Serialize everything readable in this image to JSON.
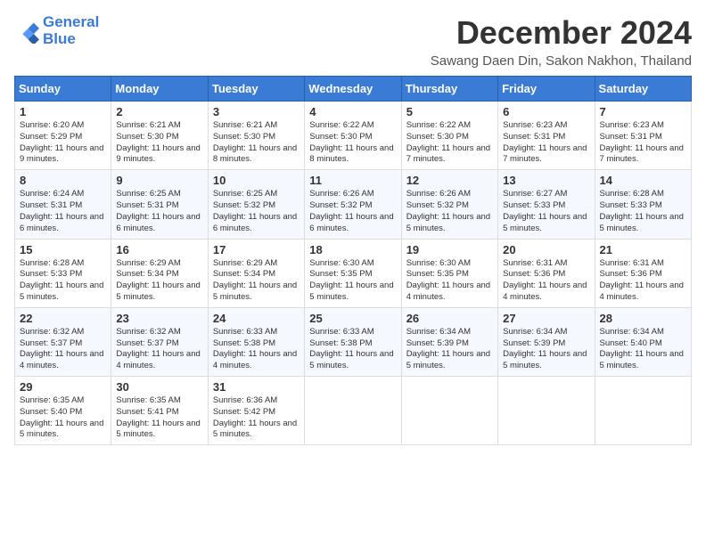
{
  "header": {
    "logo_line1": "General",
    "logo_line2": "Blue",
    "title": "December 2024",
    "location": "Sawang Daen Din, Sakon Nakhon, Thailand"
  },
  "weekdays": [
    "Sunday",
    "Monday",
    "Tuesday",
    "Wednesday",
    "Thursday",
    "Friday",
    "Saturday"
  ],
  "weeks": [
    [
      {
        "day": "1",
        "sunrise": "6:20 AM",
        "sunset": "5:29 PM",
        "daylight": "11 hours and 9 minutes."
      },
      {
        "day": "2",
        "sunrise": "6:21 AM",
        "sunset": "5:30 PM",
        "daylight": "11 hours and 9 minutes."
      },
      {
        "day": "3",
        "sunrise": "6:21 AM",
        "sunset": "5:30 PM",
        "daylight": "11 hours and 8 minutes."
      },
      {
        "day": "4",
        "sunrise": "6:22 AM",
        "sunset": "5:30 PM",
        "daylight": "11 hours and 8 minutes."
      },
      {
        "day": "5",
        "sunrise": "6:22 AM",
        "sunset": "5:30 PM",
        "daylight": "11 hours and 7 minutes."
      },
      {
        "day": "6",
        "sunrise": "6:23 AM",
        "sunset": "5:31 PM",
        "daylight": "11 hours and 7 minutes."
      },
      {
        "day": "7",
        "sunrise": "6:23 AM",
        "sunset": "5:31 PM",
        "daylight": "11 hours and 7 minutes."
      }
    ],
    [
      {
        "day": "8",
        "sunrise": "6:24 AM",
        "sunset": "5:31 PM",
        "daylight": "11 hours and 6 minutes."
      },
      {
        "day": "9",
        "sunrise": "6:25 AM",
        "sunset": "5:31 PM",
        "daylight": "11 hours and 6 minutes."
      },
      {
        "day": "10",
        "sunrise": "6:25 AM",
        "sunset": "5:32 PM",
        "daylight": "11 hours and 6 minutes."
      },
      {
        "day": "11",
        "sunrise": "6:26 AM",
        "sunset": "5:32 PM",
        "daylight": "11 hours and 6 minutes."
      },
      {
        "day": "12",
        "sunrise": "6:26 AM",
        "sunset": "5:32 PM",
        "daylight": "11 hours and 5 minutes."
      },
      {
        "day": "13",
        "sunrise": "6:27 AM",
        "sunset": "5:33 PM",
        "daylight": "11 hours and 5 minutes."
      },
      {
        "day": "14",
        "sunrise": "6:28 AM",
        "sunset": "5:33 PM",
        "daylight": "11 hours and 5 minutes."
      }
    ],
    [
      {
        "day": "15",
        "sunrise": "6:28 AM",
        "sunset": "5:33 PM",
        "daylight": "11 hours and 5 minutes."
      },
      {
        "day": "16",
        "sunrise": "6:29 AM",
        "sunset": "5:34 PM",
        "daylight": "11 hours and 5 minutes."
      },
      {
        "day": "17",
        "sunrise": "6:29 AM",
        "sunset": "5:34 PM",
        "daylight": "11 hours and 5 minutes."
      },
      {
        "day": "18",
        "sunrise": "6:30 AM",
        "sunset": "5:35 PM",
        "daylight": "11 hours and 5 minutes."
      },
      {
        "day": "19",
        "sunrise": "6:30 AM",
        "sunset": "5:35 PM",
        "daylight": "11 hours and 4 minutes."
      },
      {
        "day": "20",
        "sunrise": "6:31 AM",
        "sunset": "5:36 PM",
        "daylight": "11 hours and 4 minutes."
      },
      {
        "day": "21",
        "sunrise": "6:31 AM",
        "sunset": "5:36 PM",
        "daylight": "11 hours and 4 minutes."
      }
    ],
    [
      {
        "day": "22",
        "sunrise": "6:32 AM",
        "sunset": "5:37 PM",
        "daylight": "11 hours and 4 minutes."
      },
      {
        "day": "23",
        "sunrise": "6:32 AM",
        "sunset": "5:37 PM",
        "daylight": "11 hours and 4 minutes."
      },
      {
        "day": "24",
        "sunrise": "6:33 AM",
        "sunset": "5:38 PM",
        "daylight": "11 hours and 4 minutes."
      },
      {
        "day": "25",
        "sunrise": "6:33 AM",
        "sunset": "5:38 PM",
        "daylight": "11 hours and 5 minutes."
      },
      {
        "day": "26",
        "sunrise": "6:34 AM",
        "sunset": "5:39 PM",
        "daylight": "11 hours and 5 minutes."
      },
      {
        "day": "27",
        "sunrise": "6:34 AM",
        "sunset": "5:39 PM",
        "daylight": "11 hours and 5 minutes."
      },
      {
        "day": "28",
        "sunrise": "6:34 AM",
        "sunset": "5:40 PM",
        "daylight": "11 hours and 5 minutes."
      }
    ],
    [
      {
        "day": "29",
        "sunrise": "6:35 AM",
        "sunset": "5:40 PM",
        "daylight": "11 hours and 5 minutes."
      },
      {
        "day": "30",
        "sunrise": "6:35 AM",
        "sunset": "5:41 PM",
        "daylight": "11 hours and 5 minutes."
      },
      {
        "day": "31",
        "sunrise": "6:36 AM",
        "sunset": "5:42 PM",
        "daylight": "11 hours and 5 minutes."
      },
      null,
      null,
      null,
      null
    ]
  ],
  "labels": {
    "sunrise": "Sunrise:",
    "sunset": "Sunset:",
    "daylight": "Daylight:"
  }
}
